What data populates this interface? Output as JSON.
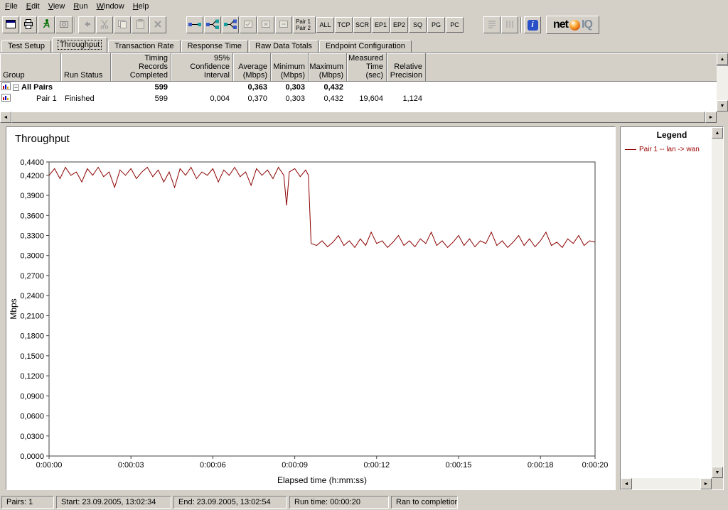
{
  "menu": {
    "items": [
      "File",
      "Edit",
      "View",
      "Run",
      "Window",
      "Help"
    ]
  },
  "icons": {
    "arrow_up": "▲",
    "arrow_down": "▼",
    "arrow_left": "◄",
    "arrow_right": "►",
    "minus": "−",
    "info": "i"
  },
  "toolbar": {
    "pair_selector": {
      "line1": "Pair 1",
      "line2": "Pair 2"
    },
    "filters": [
      "ALL",
      "TCP",
      "SCR",
      "EP1",
      "EP2",
      "SQ",
      "PG",
      "PC"
    ],
    "brand": {
      "net": "net",
      "iq": "IQ"
    }
  },
  "tabs": {
    "items": [
      "Test Setup",
      "Throughput",
      "Transaction Rate",
      "Response Time",
      "Raw Data Totals",
      "Endpoint Configuration"
    ],
    "selected": "Throughput"
  },
  "table": {
    "columns": [
      "Group",
      "Run Status",
      "Timing Records Completed",
      "95% Confidence Interval",
      "Average (Mbps)",
      "Minimum (Mbps)",
      "Maximum (Mbps)",
      "Measured Time (sec)",
      "Relative Precision"
    ],
    "rows": [
      {
        "group": "All Pairs",
        "run_status": "",
        "timing_records": "599",
        "confidence": "",
        "average": "0,363",
        "minimum": "0,303",
        "maximum": "0,432",
        "measured_time": "",
        "precision": ""
      },
      {
        "group": "Pair 1",
        "run_status": "Finished",
        "timing_records": "599",
        "confidence": "0,004",
        "average": "0,370",
        "minimum": "0,303",
        "maximum": "0,432",
        "measured_time": "19,604",
        "precision": "1,124"
      }
    ]
  },
  "legend": {
    "title": "Legend",
    "items": [
      {
        "label": "Pair 1 -- lan -> wan",
        "color": "#990000"
      }
    ]
  },
  "status": {
    "segments": [
      "Pairs: 1",
      "Start: 23.09.2005, 13:02:34",
      "End: 23.09.2005, 13:02:54",
      "Run time: 00:00:20",
      "Ran to completion"
    ]
  },
  "chart_data": {
    "type": "line",
    "title": "Throughput",
    "xlabel": "Elapsed time (h:mm:ss)",
    "ylabel": "Mbps",
    "xlim": [
      0,
      20
    ],
    "ylim": [
      0,
      0.44
    ],
    "grid": false,
    "legend_position": "right-panel",
    "x_ticks": [
      {
        "t": 0,
        "label": "0:00:00"
      },
      {
        "t": 3,
        "label": "0:00:03"
      },
      {
        "t": 6,
        "label": "0:00:06"
      },
      {
        "t": 9,
        "label": "0:00:09"
      },
      {
        "t": 12,
        "label": "0:00:12"
      },
      {
        "t": 15,
        "label": "0:00:15"
      },
      {
        "t": 18,
        "label": "0:00:18"
      },
      {
        "t": 20,
        "label": "0:00:20"
      }
    ],
    "y_ticks": [
      0.0,
      0.03,
      0.06,
      0.09,
      0.12,
      0.15,
      0.18,
      0.21,
      0.24,
      0.27,
      0.3,
      0.33,
      0.36,
      0.39,
      0.42,
      0.44
    ],
    "y_tick_labels": [
      "0,0000",
      "0,0300",
      "0,0600",
      "0,0900",
      "0,1200",
      "0,1500",
      "0,1800",
      "0,2100",
      "0,2400",
      "0,2700",
      "0,3000",
      "0,3300",
      "0,3600",
      "0,3900",
      "0,4200",
      "0,4400"
    ],
    "series": [
      {
        "name": "Pair 1 -- lan -> wan",
        "color": "#8b0000",
        "points": [
          [
            0.0,
            0.42
          ],
          [
            0.2,
            0.43
          ],
          [
            0.4,
            0.415
          ],
          [
            0.6,
            0.432
          ],
          [
            0.8,
            0.42
          ],
          [
            1.0,
            0.425
          ],
          [
            1.2,
            0.41
          ],
          [
            1.4,
            0.43
          ],
          [
            1.6,
            0.42
          ],
          [
            1.8,
            0.432
          ],
          [
            2.0,
            0.418
          ],
          [
            2.2,
            0.425
          ],
          [
            2.4,
            0.402
          ],
          [
            2.6,
            0.428
          ],
          [
            2.8,
            0.42
          ],
          [
            3.0,
            0.43
          ],
          [
            3.2,
            0.415
          ],
          [
            3.4,
            0.425
          ],
          [
            3.6,
            0.432
          ],
          [
            3.8,
            0.418
          ],
          [
            4.0,
            0.428
          ],
          [
            4.2,
            0.41
          ],
          [
            4.4,
            0.425
          ],
          [
            4.6,
            0.402
          ],
          [
            4.8,
            0.43
          ],
          [
            5.0,
            0.42
          ],
          [
            5.2,
            0.432
          ],
          [
            5.4,
            0.415
          ],
          [
            5.6,
            0.425
          ],
          [
            5.8,
            0.42
          ],
          [
            6.0,
            0.43
          ],
          [
            6.2,
            0.41
          ],
          [
            6.4,
            0.428
          ],
          [
            6.6,
            0.42
          ],
          [
            6.8,
            0.432
          ],
          [
            7.0,
            0.418
          ],
          [
            7.2,
            0.425
          ],
          [
            7.4,
            0.405
          ],
          [
            7.6,
            0.43
          ],
          [
            7.8,
            0.42
          ],
          [
            8.0,
            0.428
          ],
          [
            8.2,
            0.415
          ],
          [
            8.4,
            0.432
          ],
          [
            8.6,
            0.42
          ],
          [
            8.7,
            0.375
          ],
          [
            8.8,
            0.425
          ],
          [
            9.0,
            0.43
          ],
          [
            9.2,
            0.418
          ],
          [
            9.4,
            0.428
          ],
          [
            9.5,
            0.42
          ],
          [
            9.6,
            0.318
          ],
          [
            9.8,
            0.315
          ],
          [
            10.0,
            0.322
          ],
          [
            10.2,
            0.313
          ],
          [
            10.4,
            0.32
          ],
          [
            10.6,
            0.33
          ],
          [
            10.8,
            0.315
          ],
          [
            11.0,
            0.322
          ],
          [
            11.2,
            0.312
          ],
          [
            11.4,
            0.325
          ],
          [
            11.6,
            0.315
          ],
          [
            11.8,
            0.335
          ],
          [
            12.0,
            0.318
          ],
          [
            12.2,
            0.322
          ],
          [
            12.4,
            0.312
          ],
          [
            12.6,
            0.32
          ],
          [
            12.8,
            0.33
          ],
          [
            13.0,
            0.315
          ],
          [
            13.2,
            0.322
          ],
          [
            13.4,
            0.313
          ],
          [
            13.6,
            0.325
          ],
          [
            13.8,
            0.318
          ],
          [
            14.0,
            0.335
          ],
          [
            14.2,
            0.315
          ],
          [
            14.4,
            0.322
          ],
          [
            14.6,
            0.312
          ],
          [
            14.8,
            0.32
          ],
          [
            15.0,
            0.33
          ],
          [
            15.2,
            0.315
          ],
          [
            15.4,
            0.325
          ],
          [
            15.6,
            0.313
          ],
          [
            15.8,
            0.322
          ],
          [
            16.0,
            0.318
          ],
          [
            16.2,
            0.335
          ],
          [
            16.4,
            0.315
          ],
          [
            16.6,
            0.322
          ],
          [
            16.8,
            0.312
          ],
          [
            17.0,
            0.32
          ],
          [
            17.2,
            0.33
          ],
          [
            17.4,
            0.315
          ],
          [
            17.6,
            0.325
          ],
          [
            17.8,
            0.313
          ],
          [
            18.0,
            0.322
          ],
          [
            18.2,
            0.335
          ],
          [
            18.4,
            0.315
          ],
          [
            18.6,
            0.32
          ],
          [
            18.8,
            0.312
          ],
          [
            19.0,
            0.325
          ],
          [
            19.2,
            0.318
          ],
          [
            19.4,
            0.33
          ],
          [
            19.6,
            0.315
          ],
          [
            19.8,
            0.322
          ],
          [
            20.0,
            0.32
          ]
        ]
      }
    ]
  }
}
